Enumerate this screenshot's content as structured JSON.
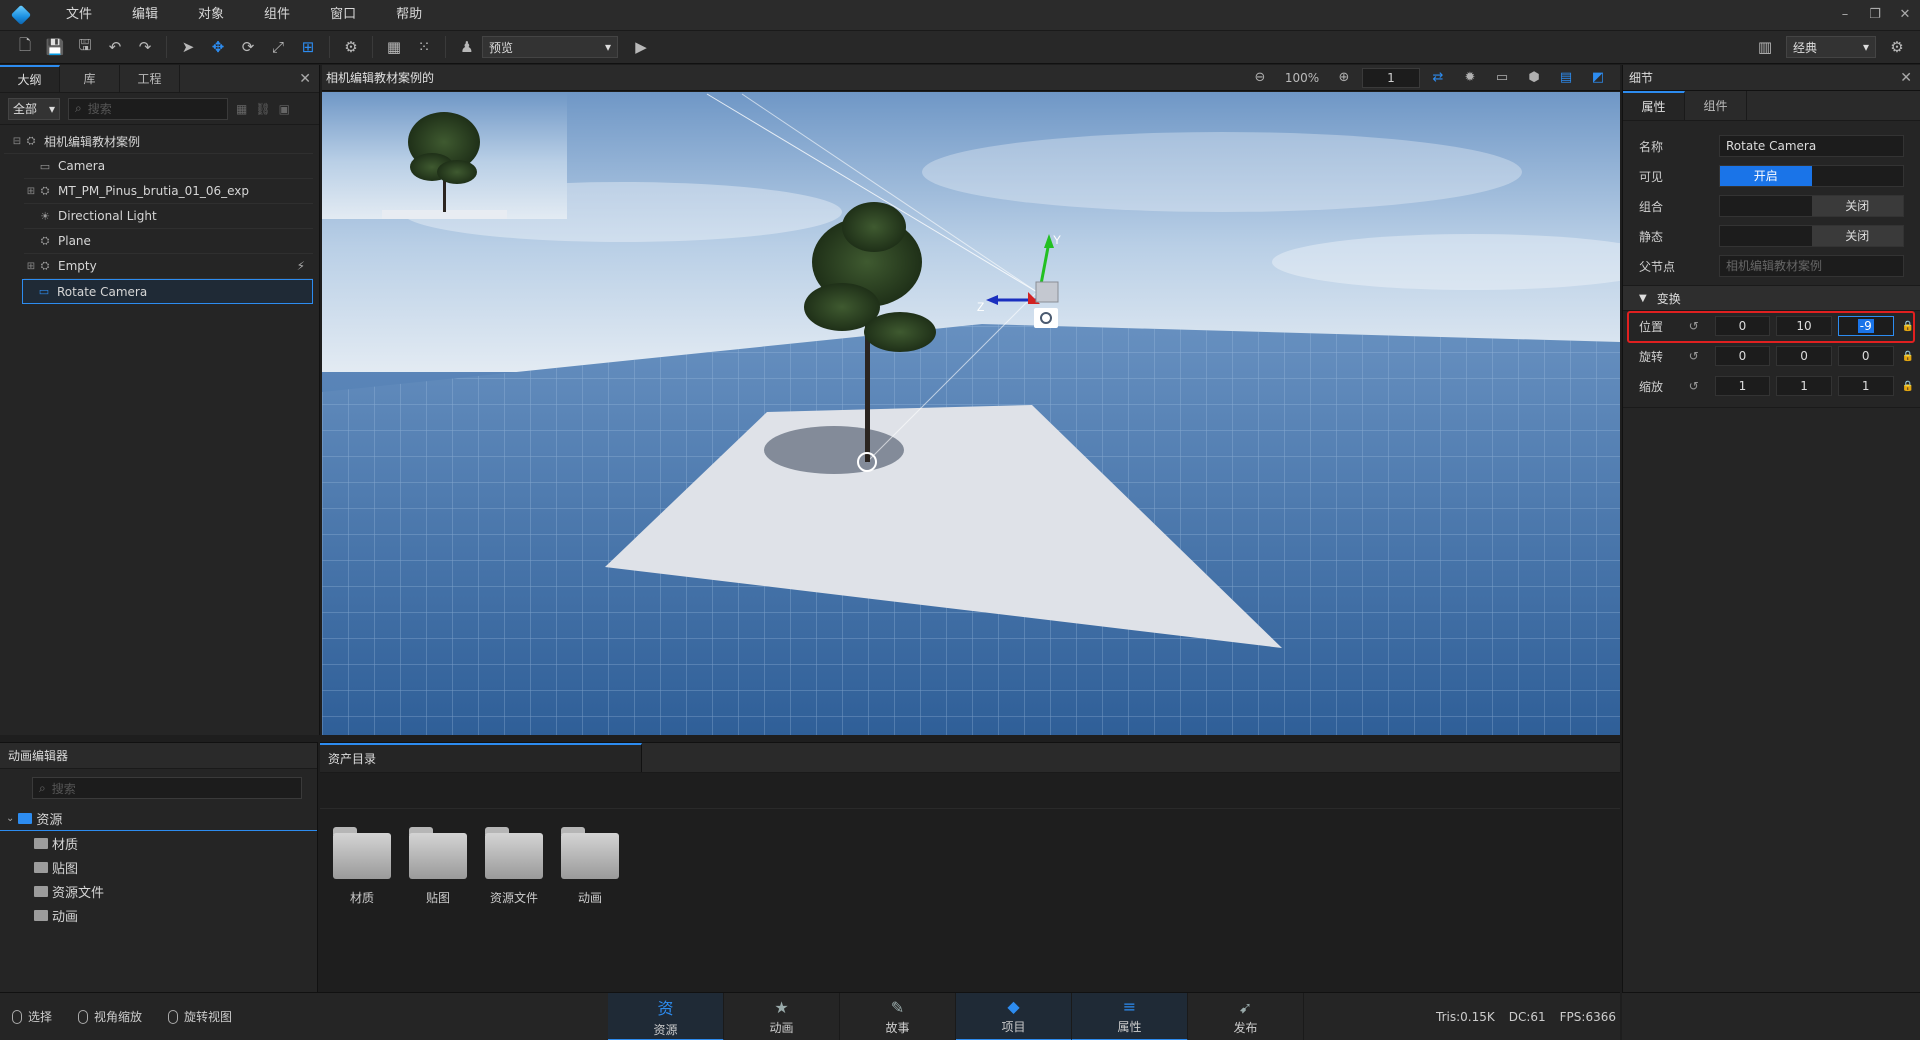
{
  "menu": [
    "文件",
    "编辑",
    "对象",
    "组件",
    "窗口",
    "帮助"
  ],
  "window_controls": [
    "–",
    "❐",
    "✕"
  ],
  "toolbar": {
    "mode_select": "预览",
    "layout_select": "经典"
  },
  "outline": {
    "tabs": [
      "大纲",
      "库",
      "工程"
    ],
    "filter": "全部",
    "search_placeholder": "搜索",
    "items": [
      {
        "label": "相机编辑教材案例",
        "icon": "group-icon",
        "level": 0,
        "expander": "⊟"
      },
      {
        "label": "Camera",
        "icon": "camera-icon",
        "level": 1,
        "expander": ""
      },
      {
        "label": "MT_PM_Pinus_brutia_01_06_exp",
        "icon": "group-icon",
        "level": 1,
        "expander": "⊞"
      },
      {
        "label": "Directional Light",
        "icon": "light-icon",
        "level": 1,
        "expander": ""
      },
      {
        "label": "Plane",
        "icon": "group-icon",
        "level": 1,
        "expander": ""
      },
      {
        "label": "Empty",
        "icon": "group-icon",
        "level": 1,
        "expander": "⊞"
      },
      {
        "label": "Rotate Camera",
        "icon": "camera-icon",
        "level": 1,
        "expander": "",
        "selected": true
      }
    ]
  },
  "viewport": {
    "title": "相机编辑教材案例的",
    "zoom": "100%",
    "frame": "1"
  },
  "detail": {
    "title": "细节",
    "tabs": [
      "属性",
      "组件"
    ],
    "name_label": "名称",
    "name_value": "Rotate Camera",
    "visible_label": "可见",
    "visible_value": "开启",
    "group_label": "组合",
    "group_value": "关闭",
    "static_label": "静态",
    "static_value": "关闭",
    "parent_label": "父节点",
    "parent_value": "相机编辑教材案例",
    "transform_label": "变换",
    "position": {
      "label": "位置",
      "x": "0",
      "y": "10",
      "z": "-9"
    },
    "rotation": {
      "label": "旋转",
      "x": "0",
      "y": "0",
      "z": "0"
    },
    "scale": {
      "label": "缩放",
      "x": "1",
      "y": "1",
      "z": "1"
    }
  },
  "anim_panel": {
    "title": "动画编辑器",
    "search_placeholder": "搜索",
    "root": "资源",
    "folders": [
      "材质",
      "贴图",
      "资源文件",
      "动画"
    ]
  },
  "asset_panel": {
    "tab": "资产目录",
    "items": [
      "材质",
      "贴图",
      "资源文件",
      "动画"
    ]
  },
  "status": {
    "hints": [
      "选择",
      "视角缩放",
      "旋转视图"
    ],
    "tabs": [
      {
        "label": "资源",
        "icon": "资",
        "active": true
      },
      {
        "label": "动画",
        "icon": "★",
        "active": false
      },
      {
        "label": "故事",
        "icon": "✎",
        "active": false
      },
      {
        "label": "项目",
        "icon": "◆",
        "active": true
      },
      {
        "label": "属性",
        "icon": "≡",
        "active": true
      },
      {
        "label": "发布",
        "icon": "➹",
        "active": false
      }
    ],
    "tris": "Tris:0.15K",
    "dc": "DC:61",
    "fps": "FPS:6366"
  },
  "colors": {
    "accent": "#2d8cf0",
    "highlight": "#e02020"
  }
}
